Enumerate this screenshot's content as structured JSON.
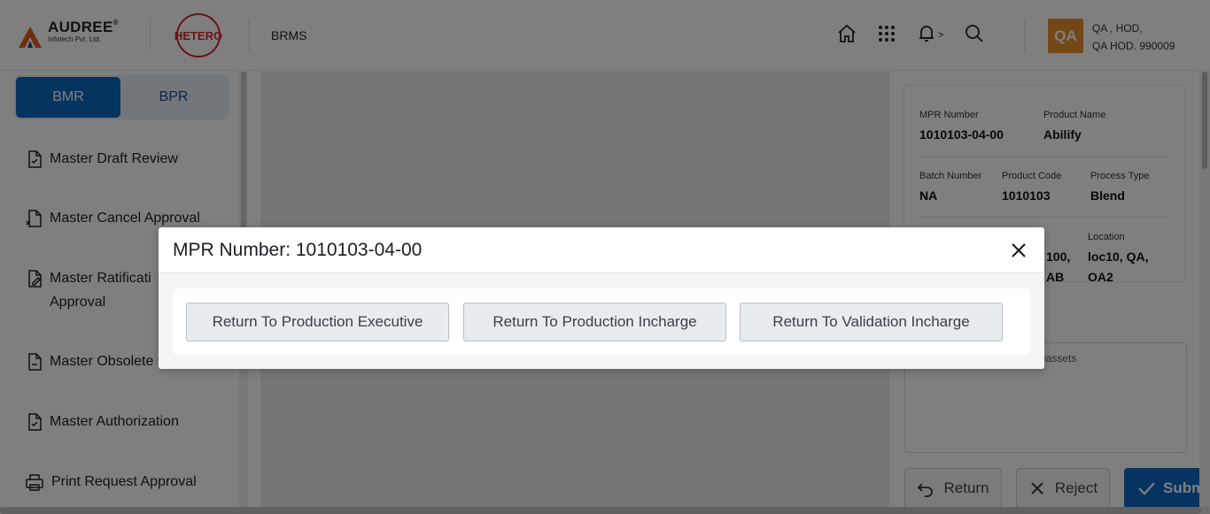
{
  "header": {
    "audree_name": "AUDREE",
    "audree_reg": "®",
    "audree_sub": "Infotech Pvt. Ltd.",
    "hetero_logo": "HETERO",
    "app_name": "BRMS",
    "icons": [
      "home-icon",
      "apps-grid-icon",
      "bell-icon",
      "search-icon"
    ],
    "notif_caret": ">",
    "avatar_initials": "QA",
    "user_line1": "QA , HOD,",
    "user_line2": "QA HOD. 990009"
  },
  "sidebar": {
    "toggle_active": "BMR",
    "toggle_inactive": "BPR",
    "items": [
      {
        "label": "Master Draft Review",
        "icon": "doc-check-icon"
      },
      {
        "label": "Master Cancel Approval",
        "icon": "doc-cancel-icon"
      },
      {
        "label": "Master Ratificati",
        "label2": "Approval",
        "icon": "doc-edit-icon"
      },
      {
        "label": "Master Obsolete",
        "icon": "doc-minus-icon"
      },
      {
        "label": "Master Authorization",
        "icon": "doc-check-icon"
      },
      {
        "label": "Print Request Approval",
        "icon": "printer-icon"
      }
    ]
  },
  "details": {
    "mpr_number_label": "MPR Number",
    "mpr_number_value": "1010103-04-00",
    "product_name_label": "Product Name",
    "product_name_value": "Abilify",
    "batch_number_label": "Batch Number",
    "batch_number_value": "NA",
    "product_code_label": "Product Code",
    "product_code_value": "1010103",
    "process_type_label": "Process Type",
    "process_type_value": "Blend",
    "partial_value_1": "100,",
    "partial_value_2": "AB",
    "location_label": "Location",
    "location_value_1": "loc10, QA,",
    "location_value_2": "OA2"
  },
  "remarks_text": "eassets",
  "actions": {
    "return_label": "Return",
    "reject_label": "Reject",
    "submit_label": "Submi"
  },
  "modal": {
    "title": "MPR Number: 1010103-04-00",
    "buttons": [
      "Return To Production Executive",
      "Return To Production Incharge",
      "Return To Validation Incharge"
    ]
  },
  "colors": {
    "primary": "#0f66c2",
    "avatar": "#e88f2c",
    "hetero_red": "#d4262c",
    "audree_orange": "#e35a1c"
  }
}
